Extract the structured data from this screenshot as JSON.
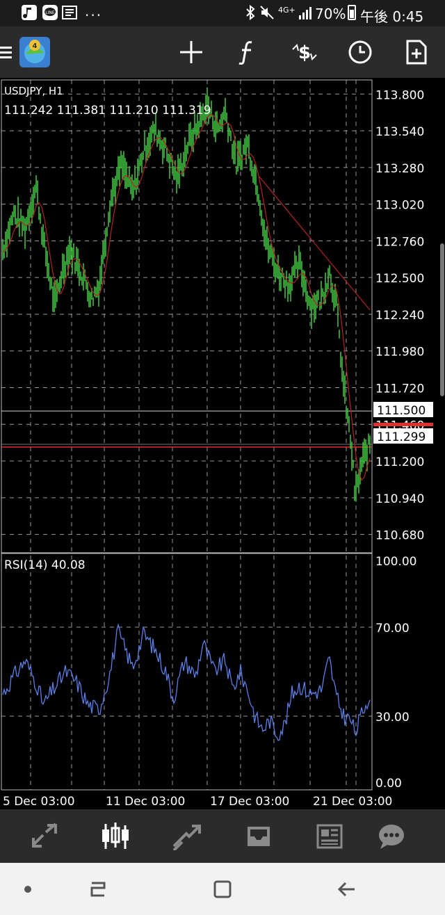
{
  "status_bar": {
    "battery": "70%",
    "time": "午後 0:45",
    "network": "4G+",
    "overflow": "..."
  },
  "chart": {
    "symbol": "USDJPY, H1",
    "ohlc": "111.242 111.381 111.210 111.319",
    "price_labels": [
      "113.800",
      "113.540",
      "113.280",
      "113.020",
      "112.760",
      "112.500",
      "112.240",
      "111.980",
      "111.720",
      "111.460",
      "111.200",
      "110.940",
      "110.680"
    ],
    "level_label": "111.500",
    "bid_label": "111.299",
    "rsi_title": "RSI(14) 40.08",
    "rsi_labels": [
      "100.00",
      "70.00",
      "30.00",
      "0.00"
    ],
    "time_labels": [
      "5 Dec 03:00",
      "11 Dec 03:00",
      "17 Dec 03:00",
      "21 Dec 03:00"
    ]
  },
  "chart_data": {
    "type": "line",
    "symbol": "USDJPY",
    "timeframe": "H1",
    "y_range": [
      110.55,
      113.9
    ],
    "horizontal_line": 111.5,
    "bid": 111.299,
    "price_series": [
      {
        "t": 0,
        "v": 112.7
      },
      {
        "t": 3,
        "v": 112.95
      },
      {
        "t": 6,
        "v": 112.85
      },
      {
        "t": 9,
        "v": 113.15
      },
      {
        "t": 11,
        "v": 112.75
      },
      {
        "t": 14,
        "v": 112.3
      },
      {
        "t": 16,
        "v": 112.55
      },
      {
        "t": 18,
        "v": 112.7
      },
      {
        "t": 21,
        "v": 112.55
      },
      {
        "t": 24,
        "v": 112.35
      },
      {
        "t": 26,
        "v": 112.45
      },
      {
        "t": 29,
        "v": 113.05
      },
      {
        "t": 32,
        "v": 113.3
      },
      {
        "t": 35,
        "v": 113.1
      },
      {
        "t": 38,
        "v": 113.4
      },
      {
        "t": 41,
        "v": 113.55
      },
      {
        "t": 44,
        "v": 113.4
      },
      {
        "t": 47,
        "v": 113.2
      },
      {
        "t": 50,
        "v": 113.45
      },
      {
        "t": 53,
        "v": 113.6
      },
      {
        "t": 55,
        "v": 113.72
      },
      {
        "t": 58,
        "v": 113.55
      },
      {
        "t": 60,
        "v": 113.68
      },
      {
        "t": 63,
        "v": 113.3
      },
      {
        "t": 66,
        "v": 113.45
      },
      {
        "t": 69,
        "v": 113.1
      },
      {
        "t": 71,
        "v": 112.75
      },
      {
        "t": 74,
        "v": 112.55
      },
      {
        "t": 77,
        "v": 112.45
      },
      {
        "t": 80,
        "v": 112.6
      },
      {
        "t": 83,
        "v": 112.3
      },
      {
        "t": 86,
        "v": 112.35
      },
      {
        "t": 88,
        "v": 112.55
      },
      {
        "t": 90,
        "v": 112.3
      },
      {
        "t": 92,
        "v": 111.7
      },
      {
        "t": 94,
        "v": 111.3
      },
      {
        "t": 95,
        "v": 110.95
      },
      {
        "t": 97,
        "v": 111.2
      },
      {
        "t": 99,
        "v": 111.32
      }
    ],
    "rsi_series": [
      {
        "t": 0,
        "v": 40
      },
      {
        "t": 3,
        "v": 48
      },
      {
        "t": 6,
        "v": 55
      },
      {
        "t": 9,
        "v": 45
      },
      {
        "t": 11,
        "v": 35
      },
      {
        "t": 14,
        "v": 43
      },
      {
        "t": 17,
        "v": 50
      },
      {
        "t": 20,
        "v": 45
      },
      {
        "t": 23,
        "v": 35
      },
      {
        "t": 26,
        "v": 33
      },
      {
        "t": 29,
        "v": 50
      },
      {
        "t": 31,
        "v": 68
      },
      {
        "t": 33,
        "v": 60
      },
      {
        "t": 35,
        "v": 52
      },
      {
        "t": 38,
        "v": 67
      },
      {
        "t": 41,
        "v": 60
      },
      {
        "t": 44,
        "v": 50
      },
      {
        "t": 46,
        "v": 38
      },
      {
        "t": 49,
        "v": 55
      },
      {
        "t": 52,
        "v": 48
      },
      {
        "t": 54,
        "v": 63
      },
      {
        "t": 57,
        "v": 50
      },
      {
        "t": 60,
        "v": 55
      },
      {
        "t": 62,
        "v": 42
      },
      {
        "t": 64,
        "v": 50
      },
      {
        "t": 66,
        "v": 42
      },
      {
        "t": 68,
        "v": 30
      },
      {
        "t": 70,
        "v": 24
      },
      {
        "t": 72,
        "v": 28
      },
      {
        "t": 74,
        "v": 22
      },
      {
        "t": 76,
        "v": 26
      },
      {
        "t": 78,
        "v": 40
      },
      {
        "t": 80,
        "v": 44
      },
      {
        "t": 83,
        "v": 40
      },
      {
        "t": 86,
        "v": 42
      },
      {
        "t": 88,
        "v": 56
      },
      {
        "t": 90,
        "v": 38
      },
      {
        "t": 92,
        "v": 30
      },
      {
        "t": 94,
        "v": 28
      },
      {
        "t": 95,
        "v": 22
      },
      {
        "t": 97,
        "v": 32
      },
      {
        "t": 99,
        "v": 40
      }
    ],
    "colors": {
      "price": "#3fbf3f",
      "ma": "#b32424",
      "rsi": "#5b7fe6",
      "bid": "#e03131",
      "grid": "#9a9a9a"
    }
  }
}
